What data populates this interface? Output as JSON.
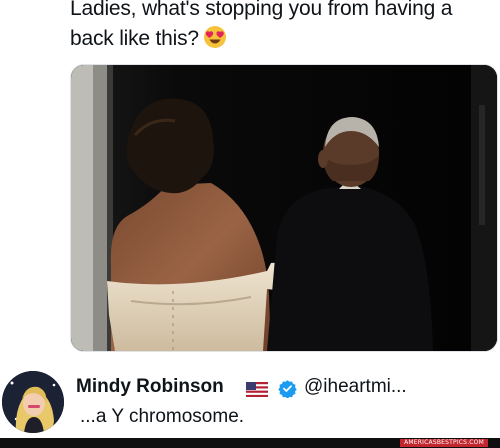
{
  "post": {
    "text_line1": "Ladies, what's stopping you from having a",
    "text_line2": "back like this?",
    "emoji": "heart-eyes-emoji",
    "photo": "photo"
  },
  "reply": {
    "name": "Mindy Robinson",
    "flag": "us-flag-icon",
    "verified": "verified-badge-icon",
    "handle": "@iheartmi...",
    "text": "...a Y chromosome."
  },
  "watermark": "AMERICASBESTPICS.COM",
  "colors": {
    "text": "#0f1419",
    "verified": "#1d9bf0",
    "watermark_bg": "#c2262e"
  }
}
